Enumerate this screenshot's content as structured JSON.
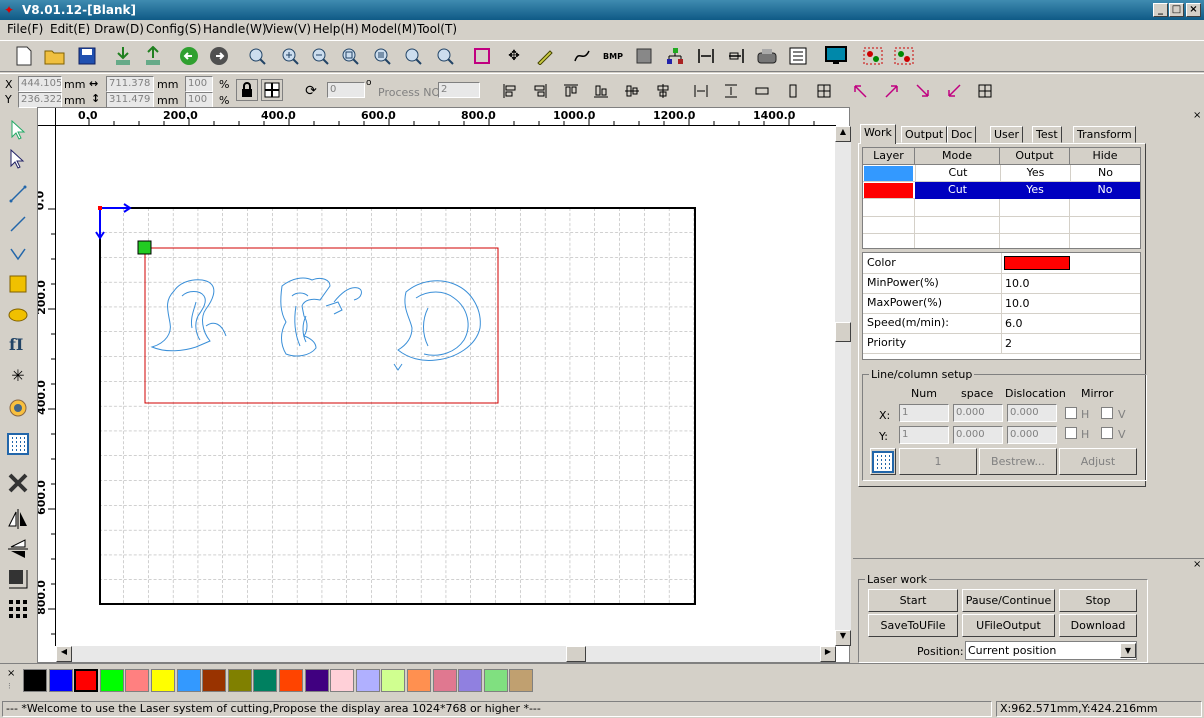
{
  "app": {
    "title": "V8.01.12-[Blank]"
  },
  "menu": [
    "File(F)",
    "Edit(E)",
    "Draw(D)",
    "Config(S)",
    "Handle(W)",
    "View(V)",
    "Help(H)",
    "Model(M)",
    "Tool(T)"
  ],
  "coords": {
    "x_label": "X",
    "y_label": "Y",
    "x_value": "444.105",
    "y_value": "236.322",
    "unit1": "mm",
    "unit2": "mm",
    "w_value": "711.378",
    "h_value": "311.479",
    "unit3": "mm",
    "unit4": "mm",
    "pct1": "100",
    "pct2": "100",
    "pct_sign1": "%",
    "pct_sign2": "%",
    "rotate_value": "0",
    "deg": "o",
    "process_label": "Process NO:",
    "process_value": "2"
  },
  "ruler": {
    "h_ticks": [
      "0.0",
      "200.0",
      "400.0",
      "600.0",
      "800.0",
      "1000.0",
      "1200.0",
      "1400.0"
    ],
    "v_ticks": [
      "0.0",
      "200.0",
      "400.0",
      "600.0",
      "800.0"
    ]
  },
  "panel": {
    "tabs": [
      "Work",
      "Output",
      "Doc",
      "User",
      "Test",
      "Transform"
    ],
    "active_tab": "Work",
    "layer_headers": [
      "Layer",
      "Mode",
      "Output",
      "Hide"
    ],
    "layers": [
      {
        "color": "#3399ff",
        "mode": "Cut",
        "output": "Yes",
        "hide": "No",
        "selected": false
      },
      {
        "color": "#ff0000",
        "mode": "Cut",
        "output": "Yes",
        "hide": "No",
        "selected": true
      }
    ],
    "props": [
      {
        "name": "Color",
        "value": ""
      },
      {
        "name": "MinPower(%)",
        "value": "10.0"
      },
      {
        "name": "MaxPower(%)",
        "value": "10.0"
      },
      {
        "name": "Speed(m/min):",
        "value": "6.0"
      },
      {
        "name": "Priority",
        "value": "2"
      }
    ],
    "prop_color": "#ff0000",
    "linecol": {
      "title": "Line/column setup",
      "headers": [
        "Num",
        "space",
        "Dislocation",
        "Mirror"
      ],
      "x_label": "X:",
      "y_label": "Y:",
      "x_num": "1",
      "x_space": "0.000",
      "x_disl": "0.000",
      "y_num": "1",
      "y_space": "0.000",
      "y_disl": "0.000",
      "h": "H",
      "v": "V",
      "btn_num": "1",
      "btn_bestrew": "Bestrew...",
      "btn_adjust": "Adjust"
    }
  },
  "laserwork": {
    "title": "Laser work",
    "buttons": [
      "Start",
      "Pause/Continue",
      "Stop",
      "SaveToUFile",
      "UFileOutput",
      "Download"
    ],
    "position_label": "Position:",
    "position_value": "Current position"
  },
  "palette": [
    "#000000",
    "#0000ff",
    "#ff0000",
    "#00ff00",
    "#ff8080",
    "#ffff00",
    "#3399ff",
    "#993300",
    "#808000",
    "#008060",
    "#ff4400",
    "#400080",
    "#ffd0d8",
    "#b0b0ff",
    "#d0ff90",
    "#ff9050",
    "#e07890",
    "#9080e0",
    "#80e080",
    "#c0a070"
  ],
  "status": {
    "message": "--- *Welcome to use the Laser system of cutting,Propose the display area 1024*768 or higher *---",
    "position": "X:962.571mm,Y:424.216mm"
  }
}
